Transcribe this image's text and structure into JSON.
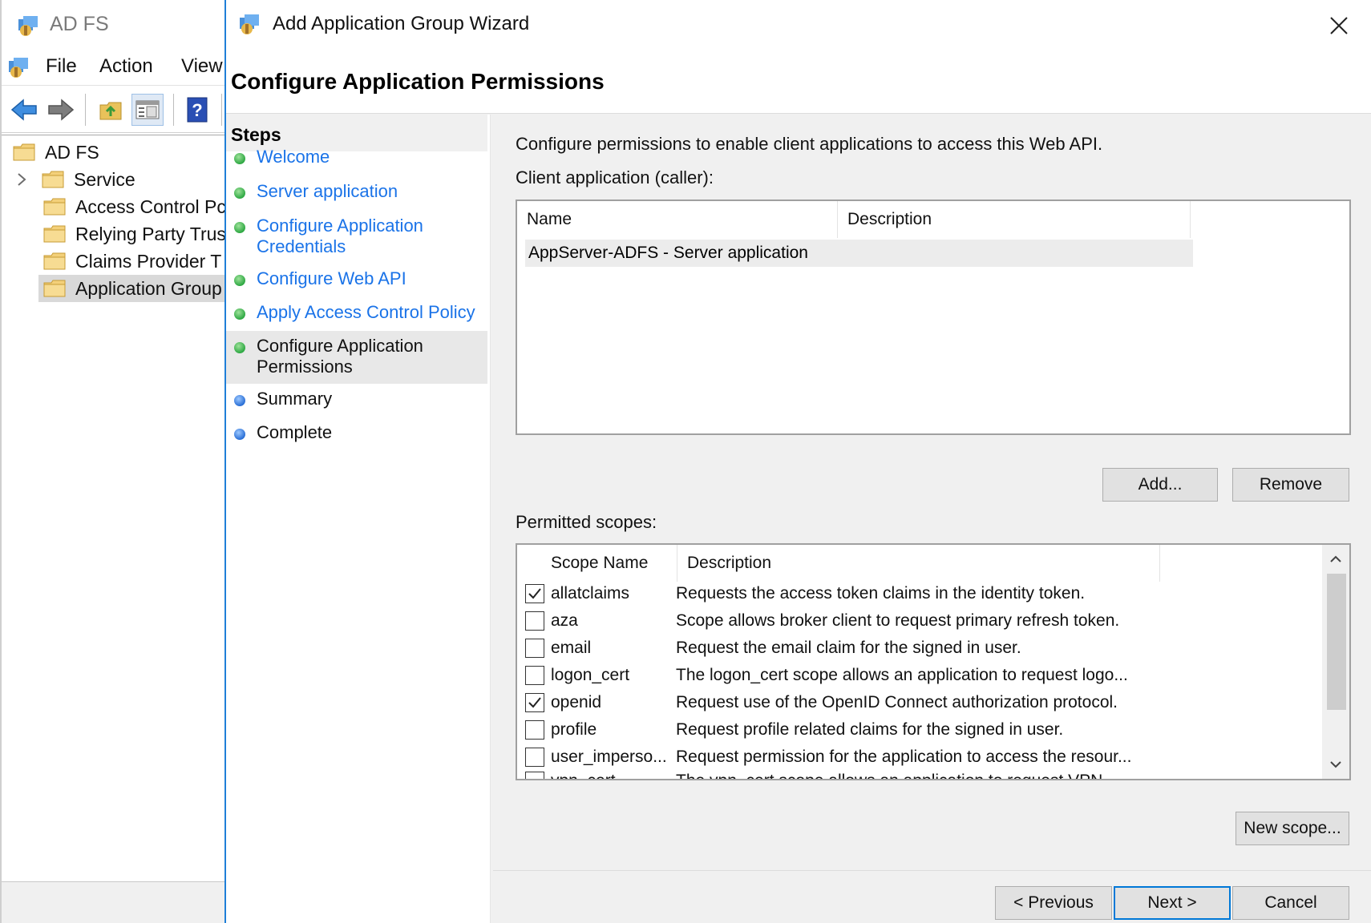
{
  "mmc": {
    "title": "AD FS",
    "menu": [
      "File",
      "Action",
      "View"
    ],
    "tree": {
      "root": "AD FS",
      "items": [
        "Service",
        "Access Control Pc",
        "Relying Party Trus",
        "Claims Provider T",
        "Application Group"
      ]
    }
  },
  "wizard": {
    "title": "Add Application Group Wizard",
    "page_title": "Configure Application Permissions",
    "steps_heading": "Steps",
    "steps": [
      {
        "label": "Welcome",
        "state": "done"
      },
      {
        "label": "Server application",
        "state": "done"
      },
      {
        "label": "Configure Application Credentials",
        "line1": "Configure Application",
        "line2": "Credentials",
        "state": "done"
      },
      {
        "label": "Configure Web API",
        "state": "done"
      },
      {
        "label": "Apply Access Control Policy",
        "state": "done"
      },
      {
        "label": "Configure Application Permissions",
        "line1": "Configure Application",
        "line2": "Permissions",
        "state": "current"
      },
      {
        "label": "Summary",
        "state": "pending"
      },
      {
        "label": "Complete",
        "state": "pending"
      }
    ],
    "intro": "Configure permissions to enable client applications to access this Web API.",
    "client_label": "Client application (caller):",
    "client_columns": [
      "Name",
      "Description"
    ],
    "client_rows": [
      {
        "name": "AppServer-ADFS - Server application",
        "description": ""
      }
    ],
    "add_button": "Add...",
    "remove_button": "Remove",
    "scopes_label": "Permitted scopes:",
    "scope_columns": [
      "Scope Name",
      "Description"
    ],
    "scopes": [
      {
        "name": "allatclaims",
        "description": "Requests the access token claims in the identity token.",
        "checked": true
      },
      {
        "name": "aza",
        "description": "Scope allows broker client to request primary refresh token.",
        "checked": false
      },
      {
        "name": "email",
        "description": "Request the email claim for the signed in user.",
        "checked": false
      },
      {
        "name": "logon_cert",
        "description": "The logon_cert scope allows an application to request logo...",
        "checked": false
      },
      {
        "name": "openid",
        "description": "Request use of the OpenID Connect authorization protocol.",
        "checked": true
      },
      {
        "name": "profile",
        "description": "Request profile related claims for the signed in user.",
        "checked": false
      },
      {
        "name": "user_imperso...",
        "description": "Request permission for the application to access the resour...",
        "checked": false
      },
      {
        "name": "vpn_cert",
        "description": "The vpn_cert scope allows an application to request VPN ...",
        "checked": false
      }
    ],
    "new_scope_button": "New scope...",
    "previous_button": "< Previous",
    "next_button": "Next >",
    "cancel_button": "Cancel"
  },
  "colors": {
    "link": "#1a73e8",
    "step_done": "#2ea843",
    "step_pending": "#2a6fd6",
    "accent": "#0078d7"
  },
  "icons": [
    "adfs-app-icon",
    "back-arrow-icon",
    "forward-arrow-icon",
    "up-folder-icon",
    "show-hide-tree-icon",
    "help-icon",
    "folder-icon",
    "chevron-right-icon",
    "close-icon",
    "checkbox-checked-icon",
    "scroll-up-icon",
    "scroll-down-icon"
  ]
}
